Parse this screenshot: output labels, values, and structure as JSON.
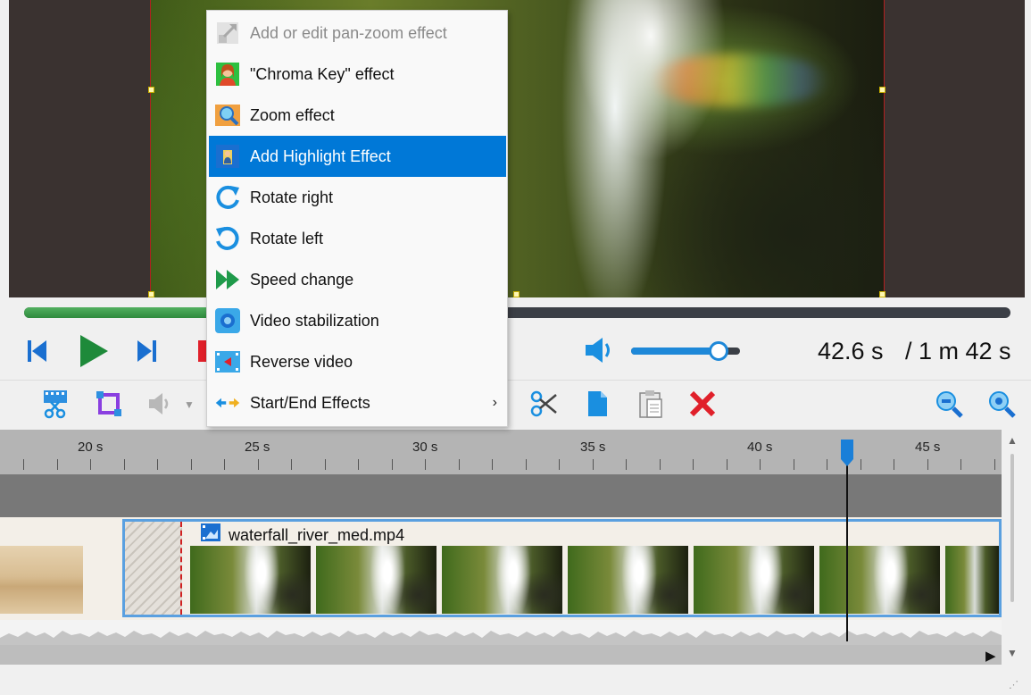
{
  "player": {
    "time_current": "42.6 s",
    "time_total": "/ 1 m 42 s",
    "progress": 0.46,
    "volume": 0.8
  },
  "context_menu": {
    "items": [
      {
        "label": "Add or edit pan-zoom effect",
        "icon": "pan-zoom-icon",
        "disabled": true
      },
      {
        "label": "\"Chroma Key\" effect",
        "icon": "chroma-key-icon"
      },
      {
        "label": "Zoom effect",
        "icon": "zoom-effect-icon"
      },
      {
        "label": "Add Highlight Effect",
        "icon": "highlight-icon",
        "highlighted": true
      },
      {
        "label": "Rotate right",
        "icon": "rotate-right-icon"
      },
      {
        "label": "Rotate left",
        "icon": "rotate-left-icon"
      },
      {
        "label": "Speed change",
        "icon": "speed-change-icon"
      },
      {
        "label": "Video stabilization",
        "icon": "stabilization-icon"
      },
      {
        "label": "Reverse video",
        "icon": "reverse-video-icon"
      },
      {
        "label": "Start/End Effects",
        "icon": "start-end-effects-icon",
        "submenu": true
      }
    ]
  },
  "timeline": {
    "ticks": [
      "20 s",
      "25 s",
      "30 s",
      "35 s",
      "40 s",
      "45 s"
    ],
    "clip_name": "waterfall_river_med.mp4"
  },
  "colors": {
    "accent": "#0078d7",
    "progress": "#2e8a3c",
    "delete": "#e0202a",
    "clip_border": "#5aa0e0"
  }
}
